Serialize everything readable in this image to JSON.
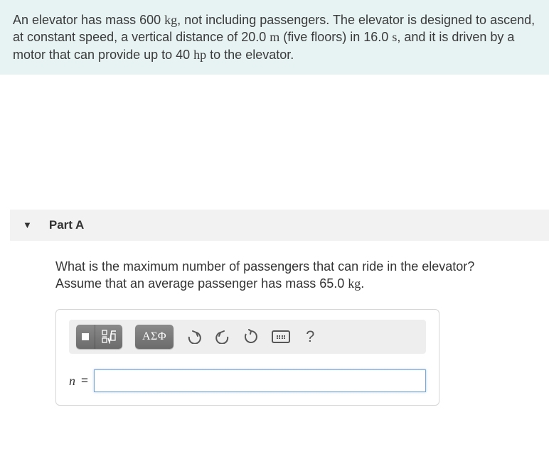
{
  "problem": {
    "pre1": "An elevator has mass 600 ",
    "u1": "kg",
    "mid1": ", not including passengers. The elevator is designed to ascend, at constant speed, a vertical distance of 20.0 ",
    "u2": "m",
    "mid2": " (five floors) in 16.0 ",
    "u3": "s",
    "mid3": ", and it is driven by a motor that can provide up to 40 ",
    "u4": "hp",
    "tail": " to the elevator."
  },
  "part": {
    "label": "Part A"
  },
  "question": {
    "line": "What is the maximum number of passengers that can ride in the elevator? Assume that an average passenger has mass 65.0 ",
    "qu": "kg",
    "tail": "."
  },
  "toolbar": {
    "greek": "ΑΣΦ",
    "help": "?"
  },
  "input": {
    "var": "n",
    "eq": "=",
    "value": ""
  }
}
